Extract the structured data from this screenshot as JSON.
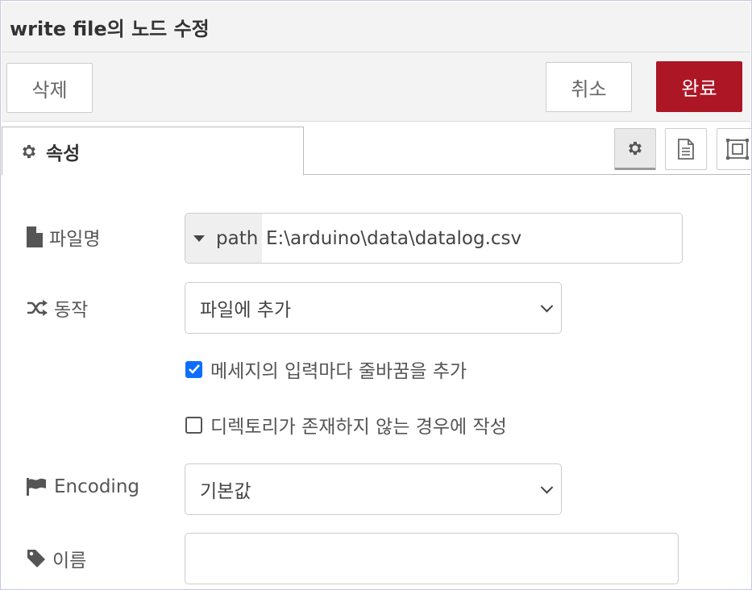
{
  "dialog": {
    "title": "write file의 노드 수정"
  },
  "toolbar": {
    "delete_label": "삭제",
    "cancel_label": "취소",
    "done_label": "완료",
    "done_color": "#ad1625"
  },
  "tabs": {
    "properties_label": "속성",
    "buttons": [
      {
        "icon": "gear-icon",
        "active": true
      },
      {
        "icon": "document-icon",
        "active": false
      },
      {
        "icon": "frame-icon",
        "active": false
      }
    ]
  },
  "form": {
    "filename": {
      "label": "파일명",
      "icon": "file-icon",
      "type": "path",
      "value": "E:\\arduino\\data\\datalog.csv"
    },
    "action": {
      "label": "동작",
      "icon": "shuffle-icon",
      "selected": "파일에 추가"
    },
    "append_newline": {
      "label": "메세지의 입력마다 줄바꿈을 추가",
      "checked": true
    },
    "create_dir": {
      "label": "디렉토리가 존재하지 않는 경우에 작성",
      "checked": false
    },
    "encoding": {
      "label": "Encoding",
      "icon": "flag-icon",
      "selected": "기본값"
    },
    "name": {
      "label": "이름",
      "icon": "tag-icon",
      "value": ""
    }
  }
}
